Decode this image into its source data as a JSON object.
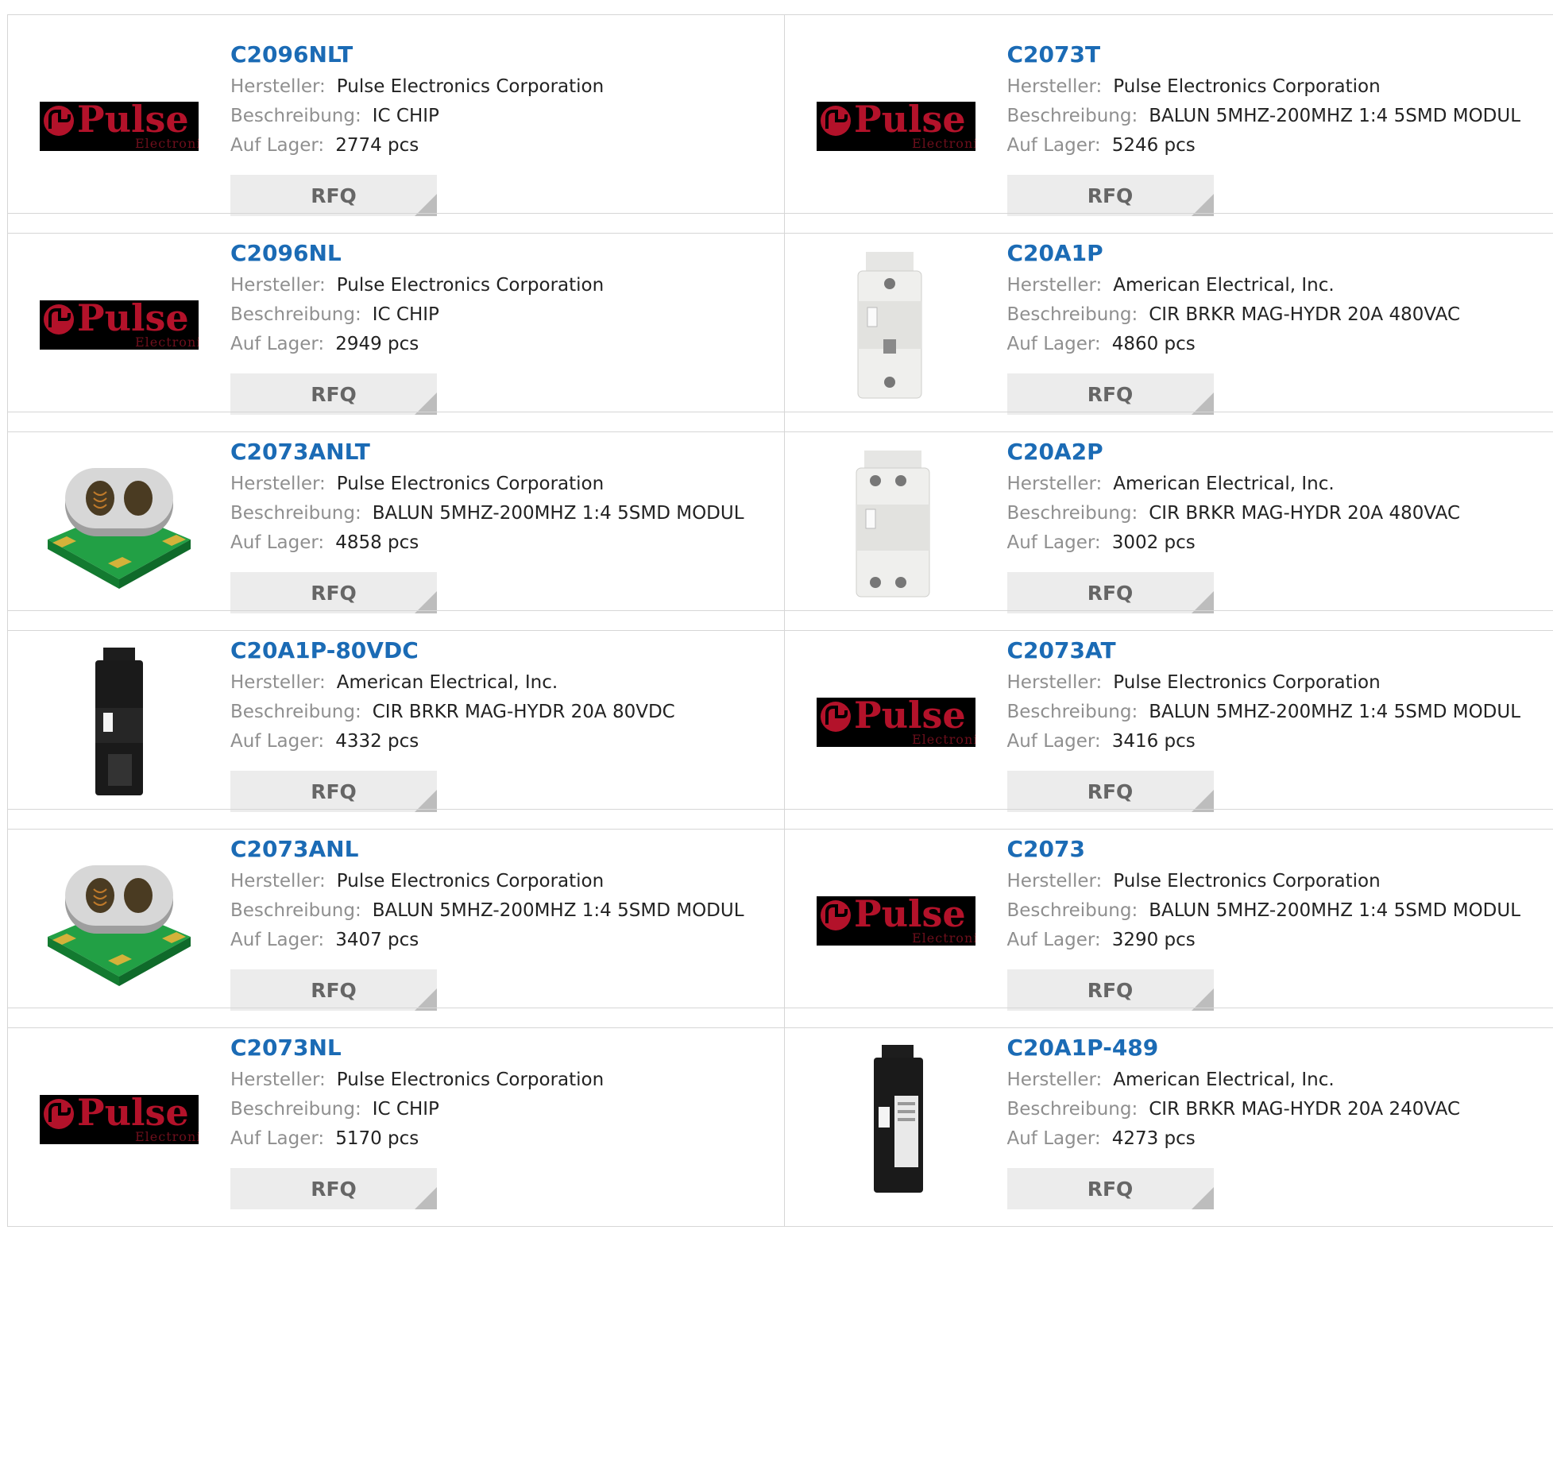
{
  "labels": {
    "manufacturer": "Hersteller:",
    "description": "Beschreibung:",
    "stock": "Auf Lager:",
    "rfq": "RFQ"
  },
  "logo_text": {
    "main": "Pulse",
    "sub": "Electronics"
  },
  "products": [
    {
      "name": "C2096NLT",
      "manufacturer": "Pulse Electronics Corporation",
      "description": "IC CHIP",
      "stock": "2774 pcs",
      "image": "pulse-logo"
    },
    {
      "name": "C2073T",
      "manufacturer": "Pulse Electronics Corporation",
      "description": "BALUN 5MHZ-200MHZ 1:4 5SMD MODUL",
      "stock": "5246 pcs",
      "image": "pulse-logo"
    },
    {
      "name": "C2096NL",
      "manufacturer": "Pulse Electronics Corporation",
      "description": "IC CHIP",
      "stock": "2949 pcs",
      "image": "pulse-logo"
    },
    {
      "name": "C20A1P",
      "manufacturer": "American Electrical, Inc.",
      "description": "CIR BRKR MAG-HYDR 20A 480VAC",
      "stock": "4860 pcs",
      "image": "white-breaker-1p"
    },
    {
      "name": "C2073ANLT",
      "manufacturer": "Pulse Electronics Corporation",
      "description": "BALUN 5MHZ-200MHZ 1:4 5SMD MODUL",
      "stock": "4858 pcs",
      "image": "balun-module"
    },
    {
      "name": "C20A2P",
      "manufacturer": "American Electrical, Inc.",
      "description": "CIR BRKR MAG-HYDR 20A 480VAC",
      "stock": "3002 pcs",
      "image": "white-breaker-2p"
    },
    {
      "name": "C20A1P-80VDC",
      "manufacturer": "American Electrical, Inc.",
      "description": "CIR BRKR MAG-HYDR 20A 80VDC",
      "stock": "4332 pcs",
      "image": "black-breaker"
    },
    {
      "name": "C2073AT",
      "manufacturer": "Pulse Electronics Corporation",
      "description": "BALUN 5MHZ-200MHZ 1:4 5SMD MODUL",
      "stock": "3416 pcs",
      "image": "pulse-logo"
    },
    {
      "name": "C2073ANL",
      "manufacturer": "Pulse Electronics Corporation",
      "description": "BALUN 5MHZ-200MHZ 1:4 5SMD MODUL",
      "stock": "3407 pcs",
      "image": "balun-module"
    },
    {
      "name": "C2073",
      "manufacturer": "Pulse Electronics Corporation",
      "description": "BALUN 5MHZ-200MHZ 1:4 5SMD MODUL",
      "stock": "3290 pcs",
      "image": "pulse-logo"
    },
    {
      "name": "C2073NL",
      "manufacturer": "Pulse Electronics Corporation",
      "description": "IC CHIP",
      "stock": "5170 pcs",
      "image": "pulse-logo"
    },
    {
      "name": "C20A1P-489",
      "manufacturer": "American Electrical, Inc.",
      "description": "CIR BRKR MAG-HYDR 20A 240VAC",
      "stock": "4273 pcs",
      "image": "black-breaker-labeled"
    }
  ]
}
